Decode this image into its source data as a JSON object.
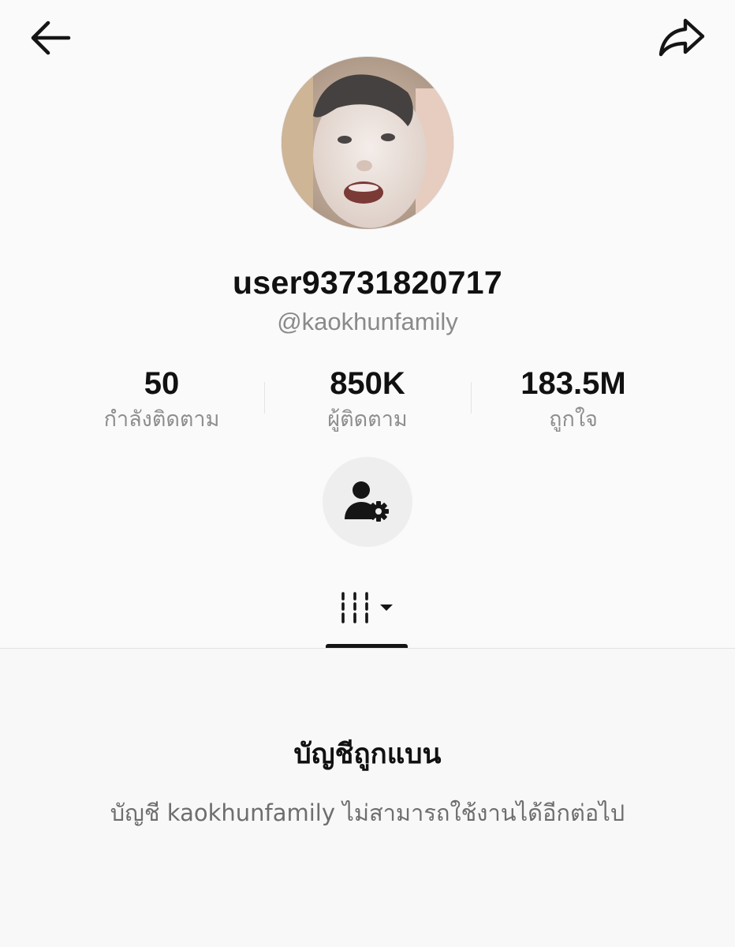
{
  "header": {
    "back_icon": "arrow-left-icon",
    "share_icon": "share-arrow-icon"
  },
  "profile": {
    "avatar_description": "profile-photo",
    "username": "user93731820717",
    "handle": "@kaokhunfamily"
  },
  "stats": [
    {
      "value": "50",
      "label": "กำลังติดตาม"
    },
    {
      "value": "850K",
      "label": "ผู้ติดตาม"
    },
    {
      "value": "183.5M",
      "label": "ถูกใจ"
    }
  ],
  "actions": {
    "settings_icon": "person-gear-icon"
  },
  "tabs": {
    "active_icon": "grid-video-icon",
    "dropdown_icon": "caret-down-icon"
  },
  "banned_notice": {
    "title": "บัญชีถูกแบน",
    "message": "บัญชี kaokhunfamily ไม่สามารถใช้งานได้อีกต่อไป"
  },
  "colors": {
    "background": "#fbfafb",
    "text_primary": "#111111",
    "text_secondary": "#8e8e8e",
    "button_bg": "#eeeeee"
  }
}
